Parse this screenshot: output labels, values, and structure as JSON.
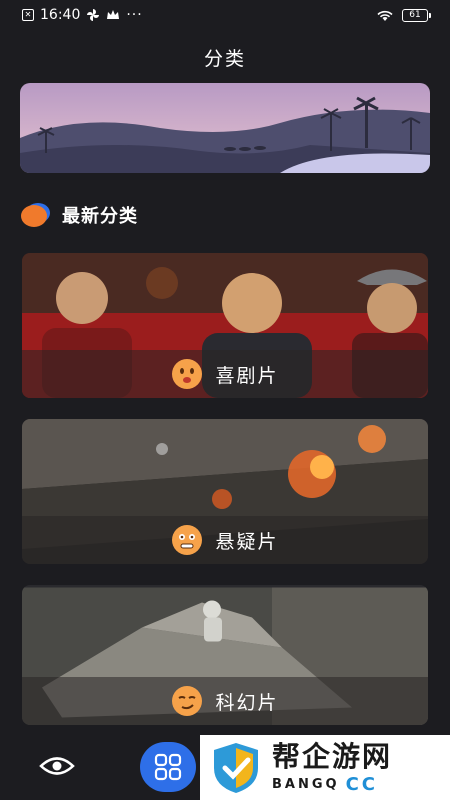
{
  "status_bar": {
    "time": "16:40",
    "battery": "61"
  },
  "header": {
    "title": "分类"
  },
  "section": {
    "title": "最新分类"
  },
  "categories": [
    {
      "label": "喜剧片",
      "face": "smile-face-icon"
    },
    {
      "label": "悬疑片",
      "face": "nervous-face-icon"
    },
    {
      "label": "科幻片",
      "face": "smirk-face-icon"
    }
  ],
  "bottom_nav": {
    "items": [
      "eye-icon",
      "grid-icon"
    ],
    "active": "grid-icon",
    "accent": "#2e6fe8"
  },
  "watermark": {
    "cn": "帮企游网",
    "en": "BANGQ",
    "cc": "CC"
  }
}
